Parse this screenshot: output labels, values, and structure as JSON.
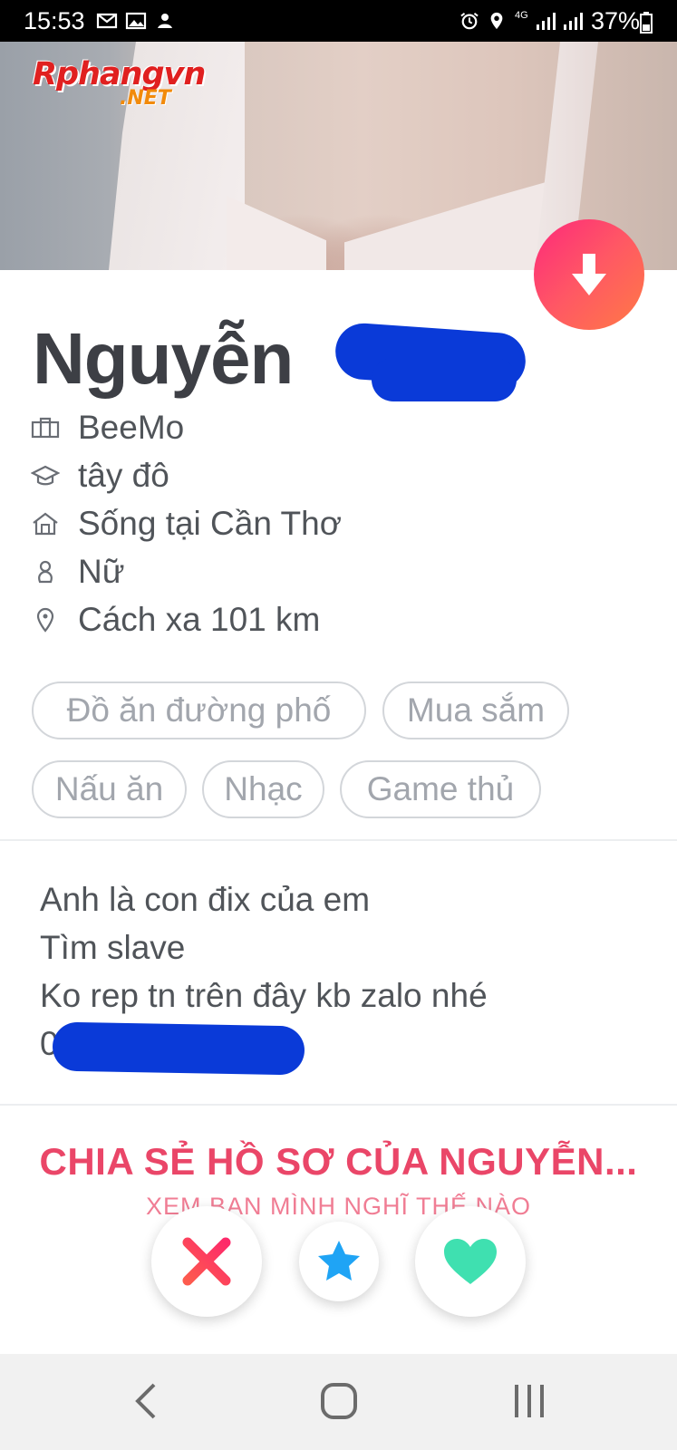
{
  "status_bar": {
    "time": "15:53",
    "battery_percent": "37%",
    "network": "4G",
    "notification_icons": [
      "gmail-icon",
      "gallery-icon",
      "app-icon"
    ],
    "system_icons": [
      "alarm-icon",
      "location-icon",
      "network-4g-icon",
      "signal-icon",
      "signal-icon",
      "battery-icon"
    ]
  },
  "photo": {
    "watermark_main": "Rphangvn",
    "watermark_sub": ".NET"
  },
  "profile": {
    "name": "Nguyễn ",
    "details": [
      {
        "icon": "briefcase-icon",
        "text": "BeeMo"
      },
      {
        "icon": "graduation-cap-icon",
        "text": "tây đô"
      },
      {
        "icon": "home-icon",
        "text": "Sống tại Cần Thơ"
      },
      {
        "icon": "person-icon",
        "text": "Nữ"
      },
      {
        "icon": "location-pin-icon",
        "text": "Cách xa 101 km"
      }
    ],
    "interests": [
      "Đồ ăn đường phố",
      "Mua sắm",
      "Nấu ăn",
      "Nhạc",
      "Game thủ"
    ],
    "bio": [
      "Anh là con đix của em",
      "Tìm slave",
      "Ko rep tn trên đây kb zalo nhé",
      "0"
    ]
  },
  "share": {
    "title": "CHIA SẺ HỒ SƠ CỦA NGUYỄN...",
    "subtitle": "XEM BẠN MÌNH NGHĨ THẾ NÀO"
  },
  "actions": [
    "nope-button",
    "super-like-button",
    "like-button"
  ],
  "colors": {
    "brand_gradient_start": "#fd297b",
    "brand_gradient_end": "#ff7a45",
    "share_text": "#ea4668",
    "super_like": "#1fa4f5",
    "like": "#3fe0b0",
    "censor_scribble": "#0a3ad8"
  },
  "nav": [
    "back-icon",
    "home-nav-icon",
    "recents-icon"
  ]
}
